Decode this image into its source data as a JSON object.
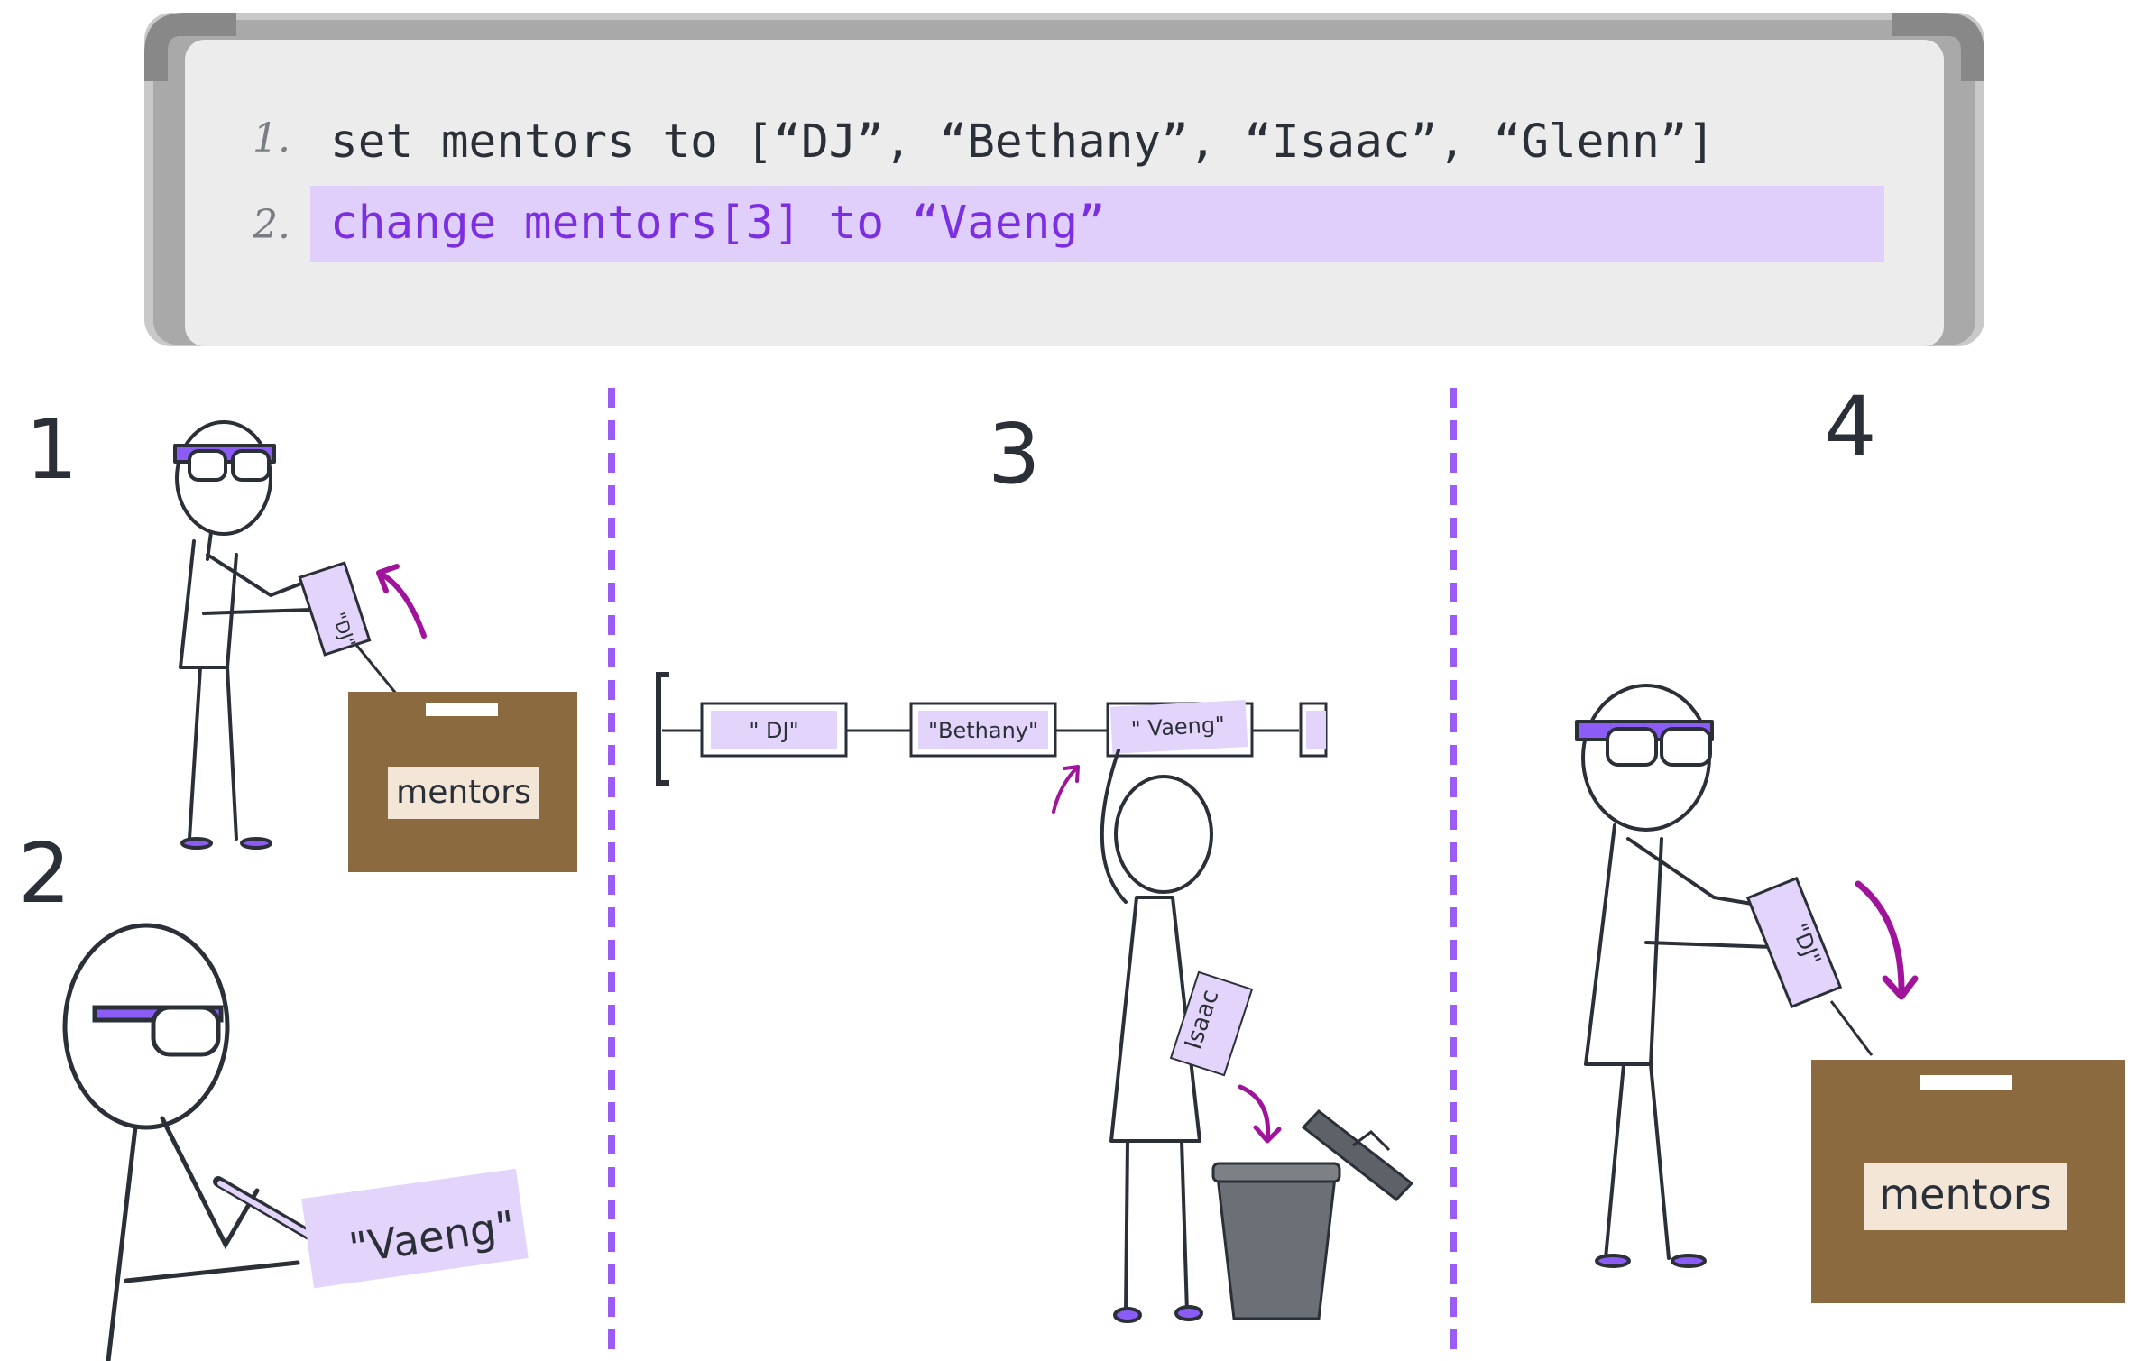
{
  "whiteboard": {
    "lines": [
      {
        "number": "1.",
        "code": "set mentors to [“DJ”, “Bethany”, “Isaac”, “Glenn”]"
      },
      {
        "number": "2.",
        "code": "change mentors[3] to “Vaeng”"
      }
    ],
    "highlight_color": "#e0cffb",
    "highlight_text_color": "#7b2fe0"
  },
  "panels": [
    {
      "number": "1"
    },
    {
      "number": "2"
    },
    {
      "number": "3"
    },
    {
      "number": "4"
    }
  ],
  "labels": {
    "box_label_left": "mentors",
    "box_label_right": "mentors",
    "slip_dj_left": "\"DJ\"",
    "slip_dj_right": "\"DJ\"",
    "slip_vaeng_written": "\"Vaeng\"",
    "array_item_1": "\" DJ\"",
    "array_item_2": "\"Bethany\"",
    "array_item_3": "\" Vaeng\"",
    "discarded_slip": "Isaac"
  },
  "colors": {
    "accent_purple": "#9b5cf6",
    "arrow_magenta": "#a0149c",
    "box_brown": "#8a6a3e",
    "ink": "#2b3038",
    "slip_purple": "#e2d4fb"
  }
}
